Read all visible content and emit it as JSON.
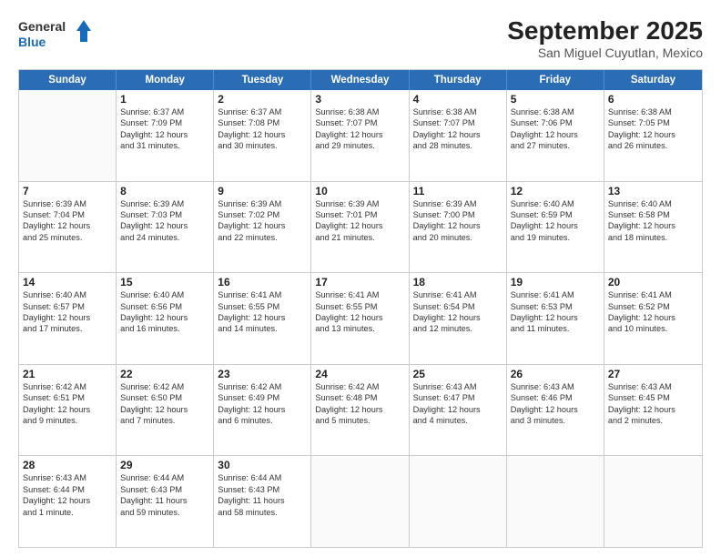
{
  "header": {
    "logo_line1": "General",
    "logo_line2": "Blue",
    "month": "September 2025",
    "location": "San Miguel Cuyutlan, Mexico"
  },
  "weekdays": [
    "Sunday",
    "Monday",
    "Tuesday",
    "Wednesday",
    "Thursday",
    "Friday",
    "Saturday"
  ],
  "rows": [
    [
      {
        "day": "",
        "info": ""
      },
      {
        "day": "1",
        "info": "Sunrise: 6:37 AM\nSunset: 7:09 PM\nDaylight: 12 hours\nand 31 minutes."
      },
      {
        "day": "2",
        "info": "Sunrise: 6:37 AM\nSunset: 7:08 PM\nDaylight: 12 hours\nand 30 minutes."
      },
      {
        "day": "3",
        "info": "Sunrise: 6:38 AM\nSunset: 7:07 PM\nDaylight: 12 hours\nand 29 minutes."
      },
      {
        "day": "4",
        "info": "Sunrise: 6:38 AM\nSunset: 7:07 PM\nDaylight: 12 hours\nand 28 minutes."
      },
      {
        "day": "5",
        "info": "Sunrise: 6:38 AM\nSunset: 7:06 PM\nDaylight: 12 hours\nand 27 minutes."
      },
      {
        "day": "6",
        "info": "Sunrise: 6:38 AM\nSunset: 7:05 PM\nDaylight: 12 hours\nand 26 minutes."
      }
    ],
    [
      {
        "day": "7",
        "info": "Sunrise: 6:39 AM\nSunset: 7:04 PM\nDaylight: 12 hours\nand 25 minutes."
      },
      {
        "day": "8",
        "info": "Sunrise: 6:39 AM\nSunset: 7:03 PM\nDaylight: 12 hours\nand 24 minutes."
      },
      {
        "day": "9",
        "info": "Sunrise: 6:39 AM\nSunset: 7:02 PM\nDaylight: 12 hours\nand 22 minutes."
      },
      {
        "day": "10",
        "info": "Sunrise: 6:39 AM\nSunset: 7:01 PM\nDaylight: 12 hours\nand 21 minutes."
      },
      {
        "day": "11",
        "info": "Sunrise: 6:39 AM\nSunset: 7:00 PM\nDaylight: 12 hours\nand 20 minutes."
      },
      {
        "day": "12",
        "info": "Sunrise: 6:40 AM\nSunset: 6:59 PM\nDaylight: 12 hours\nand 19 minutes."
      },
      {
        "day": "13",
        "info": "Sunrise: 6:40 AM\nSunset: 6:58 PM\nDaylight: 12 hours\nand 18 minutes."
      }
    ],
    [
      {
        "day": "14",
        "info": "Sunrise: 6:40 AM\nSunset: 6:57 PM\nDaylight: 12 hours\nand 17 minutes."
      },
      {
        "day": "15",
        "info": "Sunrise: 6:40 AM\nSunset: 6:56 PM\nDaylight: 12 hours\nand 16 minutes."
      },
      {
        "day": "16",
        "info": "Sunrise: 6:41 AM\nSunset: 6:55 PM\nDaylight: 12 hours\nand 14 minutes."
      },
      {
        "day": "17",
        "info": "Sunrise: 6:41 AM\nSunset: 6:55 PM\nDaylight: 12 hours\nand 13 minutes."
      },
      {
        "day": "18",
        "info": "Sunrise: 6:41 AM\nSunset: 6:54 PM\nDaylight: 12 hours\nand 12 minutes."
      },
      {
        "day": "19",
        "info": "Sunrise: 6:41 AM\nSunset: 6:53 PM\nDaylight: 12 hours\nand 11 minutes."
      },
      {
        "day": "20",
        "info": "Sunrise: 6:41 AM\nSunset: 6:52 PM\nDaylight: 12 hours\nand 10 minutes."
      }
    ],
    [
      {
        "day": "21",
        "info": "Sunrise: 6:42 AM\nSunset: 6:51 PM\nDaylight: 12 hours\nand 9 minutes."
      },
      {
        "day": "22",
        "info": "Sunrise: 6:42 AM\nSunset: 6:50 PM\nDaylight: 12 hours\nand 7 minutes."
      },
      {
        "day": "23",
        "info": "Sunrise: 6:42 AM\nSunset: 6:49 PM\nDaylight: 12 hours\nand 6 minutes."
      },
      {
        "day": "24",
        "info": "Sunrise: 6:42 AM\nSunset: 6:48 PM\nDaylight: 12 hours\nand 5 minutes."
      },
      {
        "day": "25",
        "info": "Sunrise: 6:43 AM\nSunset: 6:47 PM\nDaylight: 12 hours\nand 4 minutes."
      },
      {
        "day": "26",
        "info": "Sunrise: 6:43 AM\nSunset: 6:46 PM\nDaylight: 12 hours\nand 3 minutes."
      },
      {
        "day": "27",
        "info": "Sunrise: 6:43 AM\nSunset: 6:45 PM\nDaylight: 12 hours\nand 2 minutes."
      }
    ],
    [
      {
        "day": "28",
        "info": "Sunrise: 6:43 AM\nSunset: 6:44 PM\nDaylight: 12 hours\nand 1 minute."
      },
      {
        "day": "29",
        "info": "Sunrise: 6:44 AM\nSunset: 6:43 PM\nDaylight: 11 hours\nand 59 minutes."
      },
      {
        "day": "30",
        "info": "Sunrise: 6:44 AM\nSunset: 6:43 PM\nDaylight: 11 hours\nand 58 minutes."
      },
      {
        "day": "",
        "info": ""
      },
      {
        "day": "",
        "info": ""
      },
      {
        "day": "",
        "info": ""
      },
      {
        "day": "",
        "info": ""
      }
    ]
  ]
}
